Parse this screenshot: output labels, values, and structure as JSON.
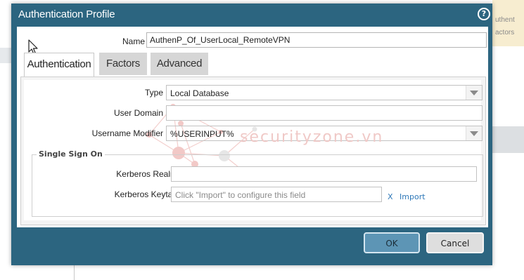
{
  "background": {
    "right_panel_lines": [
      "uthent",
      "actors"
    ]
  },
  "dialog": {
    "title": "Authentication Profile",
    "help_icon": "question-mark-circle-icon",
    "name_label": "Name",
    "name_value": "AuthenP_Of_UserLocal_RemoteVPN",
    "tabs": [
      {
        "label": "Authentication",
        "active": true
      },
      {
        "label": "Factors",
        "active": false
      },
      {
        "label": "Advanced",
        "active": false
      }
    ],
    "fields": {
      "type": {
        "label": "Type",
        "value": "Local Database"
      },
      "user_domain": {
        "label": "User Domain",
        "value": ""
      },
      "username_modifier": {
        "label": "Username Modifier",
        "value": "%USERINPUT%"
      }
    },
    "sso": {
      "legend": "Single Sign On",
      "kerberos_realm": {
        "label": "Kerberos Realm",
        "value": ""
      },
      "kerberos_keytab": {
        "label": "Kerberos Keytab",
        "placeholder": "Click \"Import\" to configure this field"
      },
      "import_icon": "x-icon",
      "import_label": "Import"
    },
    "buttons": {
      "ok": "OK",
      "cancel": "Cancel"
    }
  },
  "watermark": "securityzone.vn",
  "colors": {
    "dialog_frame": "#2c6580",
    "ok_button": "#5d95b5",
    "link": "#2e78b8",
    "watermark": "#f0c9c7"
  }
}
